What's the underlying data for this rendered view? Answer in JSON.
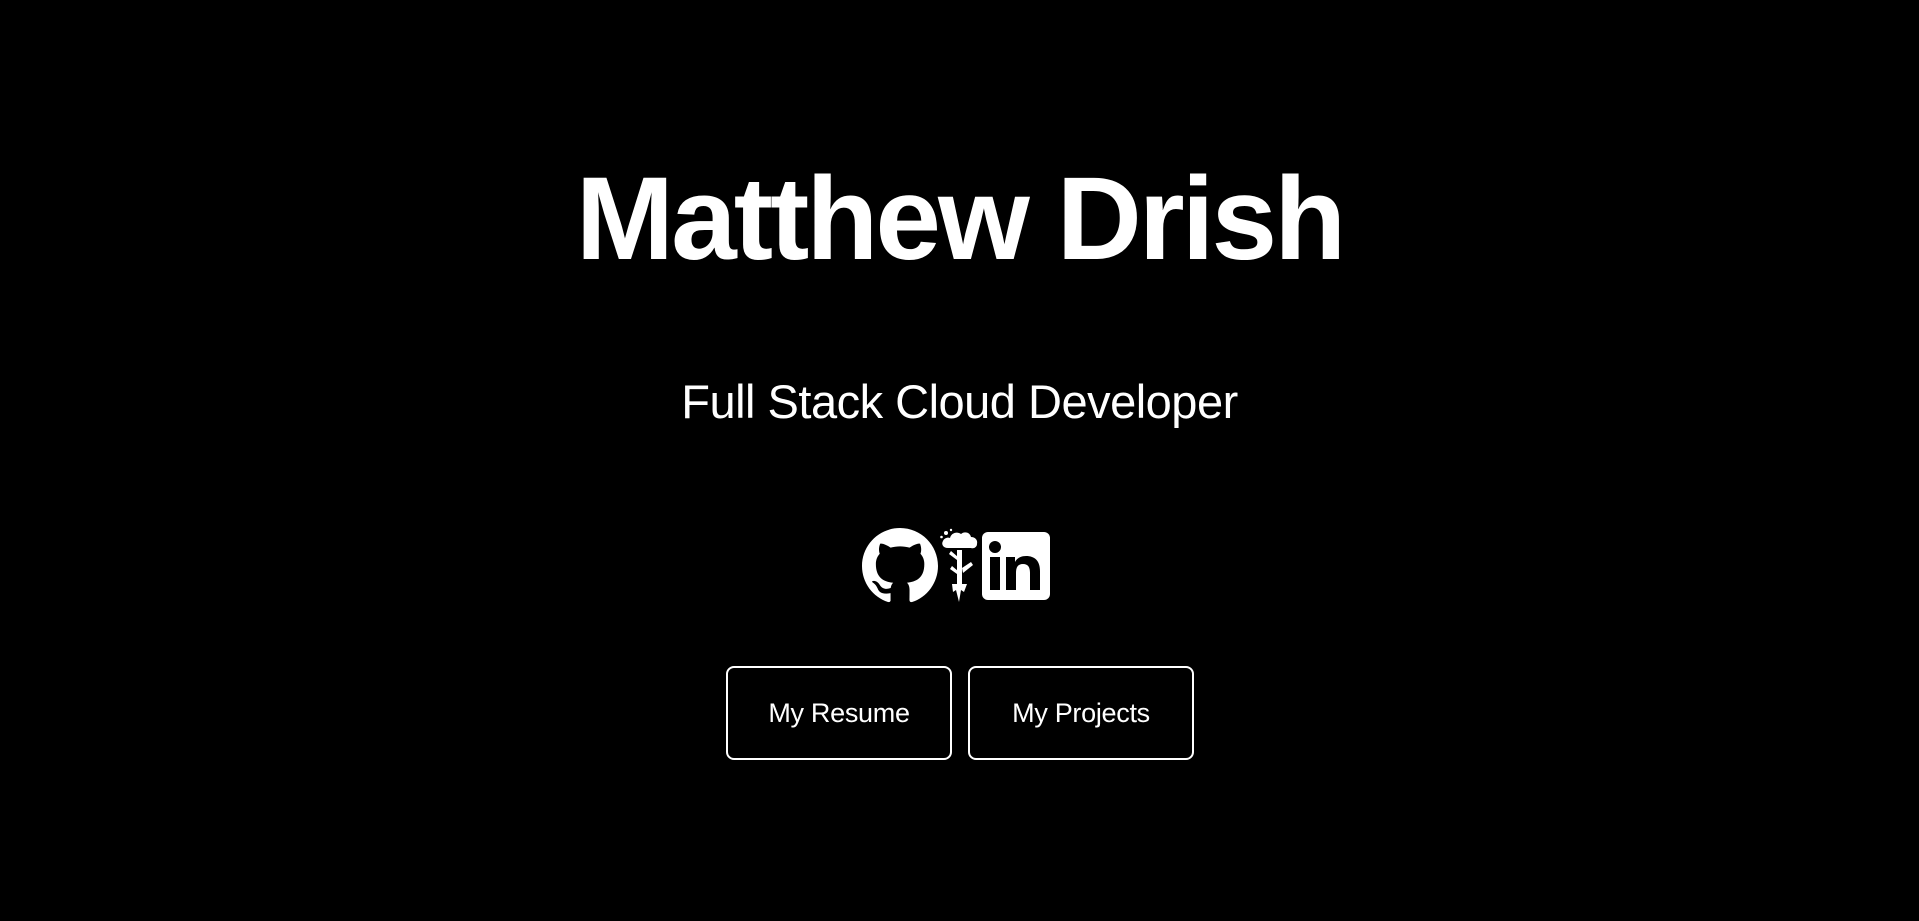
{
  "header": {
    "name": "Matthew Drish",
    "tagline": "Full Stack Cloud Developer"
  },
  "social": [
    {
      "icon": "github-icon",
      "label": "GitHub"
    },
    {
      "icon": "cloud-tree-icon",
      "label": "Cloud"
    },
    {
      "icon": "linkedin-icon",
      "label": "LinkedIn"
    }
  ],
  "buttons": {
    "resume_label": "My Resume",
    "projects_label": "My Projects"
  },
  "colors": {
    "background": "#000000",
    "foreground": "#ffffff"
  }
}
